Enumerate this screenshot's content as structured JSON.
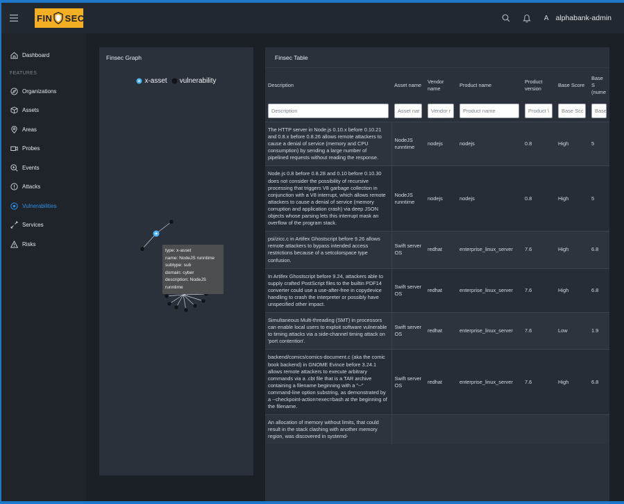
{
  "header": {
    "logo_left": "FIN",
    "logo_right": "SEC",
    "user_initial": "A",
    "user_name": "alphabank-admin"
  },
  "sidebar": {
    "items": [
      {
        "label": "Dashboard",
        "icon": "home-icon",
        "active": false
      },
      {
        "label": "Organizations",
        "icon": "compass-icon",
        "active": false
      },
      {
        "label": "Assets",
        "icon": "cube-icon",
        "active": false
      },
      {
        "label": "Areas",
        "icon": "location-pin-icon",
        "active": false
      },
      {
        "label": "Probes",
        "icon": "camera-icon",
        "active": false
      },
      {
        "label": "Events",
        "icon": "magnifier-plus-icon",
        "active": false
      },
      {
        "label": "Attacks",
        "icon": "alert-circle-icon",
        "active": false
      },
      {
        "label": "Vulnerabilities",
        "icon": "target-icon",
        "active": true
      },
      {
        "label": "Services",
        "icon": "arrows-icon",
        "active": false
      },
      {
        "label": "Risks",
        "icon": "warning-triangle-icon",
        "active": false
      }
    ],
    "section_label": "FEATURES"
  },
  "graph": {
    "title": "Finsec Graph",
    "legend": [
      "x-asset",
      "vulnerability"
    ],
    "tooltip": {
      "type": "type: x-asset",
      "name": "name: NodeJS runntime",
      "subtype": "subtype: sub",
      "domain": "domain: cyber",
      "description": "description: NodeJS runntime"
    }
  },
  "table": {
    "title": "Finsec Table",
    "columns": [
      {
        "label": "Description",
        "placeholder": "Description"
      },
      {
        "label": "Asset name",
        "placeholder": "Asset nar"
      },
      {
        "label": "Vendor name",
        "placeholder": "Vendor r"
      },
      {
        "label": "Product name",
        "placeholder": "Product name"
      },
      {
        "label": "Product version",
        "placeholder": "Product \\"
      },
      {
        "label": "Base Score",
        "placeholder": "Base Scc"
      },
      {
        "label": "Base S (nume",
        "placeholder": "Base S"
      }
    ],
    "rows": [
      {
        "description": "The HTTP server in Node.js 0.10.x before 0.10.21 and 0.8.x before 0.8.26 allows remote attackers to cause a denial of service (memory and CPU consumption) by sending a large number of pipelined requests without reading the response.",
        "asset": "NodeJS runntime",
        "vendor": "nodejs",
        "product": "nodejs",
        "version": "0.8",
        "score": "High",
        "numeric": "5"
      },
      {
        "description": "Node.js 0.8 before 0.8.28 and 0.10 before 0.10.30 does not consider the possibility of recursive processing that triggers V8 garbage collection in conjunction with a V8 interrupt, which allows remote attackers to cause a denial of service (memory corruption and application crash) via deep JSON objects whose parsing lets this interrupt mask an overflow of the program stack.",
        "asset": "NodeJS runntime",
        "vendor": "nodejs",
        "product": "nodejs",
        "version": "0.8",
        "score": "High",
        "numeric": "5"
      },
      {
        "description": "psi/zicc.c in Artifex Ghostscript before 9.26 allows remote attackers to bypass intended access restrictions because of a setcolorspace type confusion.",
        "asset": "Swift server OS",
        "vendor": "redhat",
        "product": "enterprise_linux_server",
        "version": "7.6",
        "score": "High",
        "numeric": "6.8"
      },
      {
        "description": "In Artifex Ghostscript before 9.24, attackers able to supply crafted PostScript files to the builtin PDF14 converter could use a use-after-free in copydevice handling to crash the interpreter or possibly have unspecified other impact.",
        "asset": "Swift server OS",
        "vendor": "redhat",
        "product": "enterprise_linux_server",
        "version": "7.6",
        "score": "High",
        "numeric": "6.8"
      },
      {
        "description": "Simultaneous Multi-threading (SMT) in processors can enable local users to exploit software vulnerable to timing attacks via a side-channel timing attack on 'port contention'.",
        "asset": "Swift server OS",
        "vendor": "redhat",
        "product": "enterprise_linux_server",
        "version": "7.6",
        "score": "Low",
        "numeric": "1.9"
      },
      {
        "description": "backend/comics/comics-document.c (aka the comic book backend) in GNOME Evince before 3.24.1 allows remote attackers to execute arbitrary commands via a .cbt file that is a TAR archive containing a filename beginning with a \"--\" command-line option substring, as demonstrated by a --checkpoint-action=exec=bash at the beginning of the filename.",
        "asset": "Swift server OS",
        "vendor": "redhat",
        "product": "enterprise_linux_server",
        "version": "7.6",
        "score": "High",
        "numeric": "6.8"
      },
      {
        "description": "An allocation of memory without limits, that could result in the stack clashing with another memory region, was discovered in systemd-",
        "asset": "",
        "vendor": "",
        "product": "",
        "version": "",
        "score": "",
        "numeric": ""
      }
    ]
  },
  "colors": {
    "frame_blue": "#1e78c8",
    "logo_orange": "#f4ae24",
    "active_blue": "#2f8fe6",
    "asset_node": "#4fb3f2",
    "vuln_node": "#111418"
  }
}
